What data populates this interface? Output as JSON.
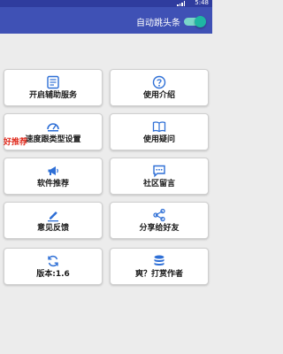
{
  "status": {
    "time": "5:48"
  },
  "header": {
    "toggle_label": "自动跳头条",
    "toggle_on": true
  },
  "badge": "好推荐",
  "cards": {
    "accessibility": "开启辅助服务",
    "intro": "使用介绍",
    "speed": "速度跟类型设置",
    "faq": "使用疑问",
    "recommend": "软件推荐",
    "community": "社区留言",
    "feedback": "意见反馈",
    "share": "分享给好友",
    "version": "版本:1.6",
    "tip": "爽？打赏作者"
  },
  "colors": {
    "accent": "#2e6fd6",
    "appbar": "#3f51b5",
    "toggle": "#1fb6a3",
    "badge": "#e02b1d"
  }
}
